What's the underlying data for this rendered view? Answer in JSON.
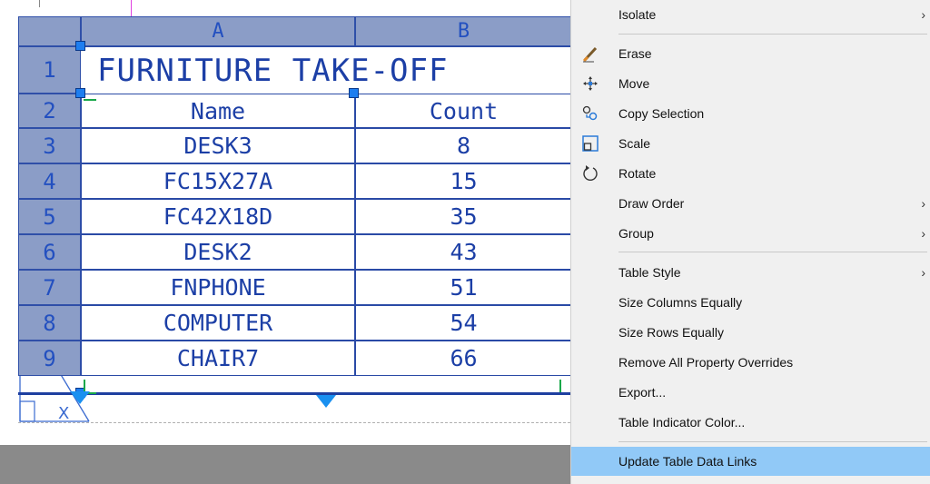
{
  "table": {
    "column_headers": [
      "A",
      "B"
    ],
    "row_numbers": [
      "1",
      "2",
      "3",
      "4",
      "5",
      "6",
      "7",
      "8",
      "9"
    ],
    "title": "FURNITURE TAKE-OFF",
    "header_row": [
      "Name",
      "Count"
    ],
    "rows": [
      [
        "DESK3",
        "8"
      ],
      [
        "FC15X27A",
        "15"
      ],
      [
        "FC42X18D",
        "35"
      ],
      [
        "DESK2",
        "43"
      ],
      [
        "FNPHONE",
        "51"
      ],
      [
        "COMPUTER",
        "54"
      ],
      [
        "CHAIR7",
        "66"
      ]
    ]
  },
  "context_menu": {
    "items": [
      {
        "label": "Isolate",
        "icon": "none",
        "submenu": true
      },
      {
        "label": "Erase",
        "icon": "eraser-icon",
        "submenu": false
      },
      {
        "label": "Move",
        "icon": "move-icon",
        "submenu": false
      },
      {
        "label": "Copy Selection",
        "icon": "copy-icon",
        "submenu": false
      },
      {
        "label": "Scale",
        "icon": "scale-icon",
        "submenu": false
      },
      {
        "label": "Rotate",
        "icon": "rotate-icon",
        "submenu": false
      },
      {
        "label": "Draw Order",
        "icon": "none",
        "submenu": true
      },
      {
        "label": "Group",
        "icon": "none",
        "submenu": true
      },
      {
        "label": "Table Style",
        "icon": "none",
        "submenu": true
      },
      {
        "label": "Size Columns Equally",
        "icon": "none",
        "submenu": false
      },
      {
        "label": "Size Rows Equally",
        "icon": "none",
        "submenu": false
      },
      {
        "label": "Remove All Property Overrides",
        "icon": "none",
        "submenu": false
      },
      {
        "label": "Export...",
        "icon": "none",
        "submenu": false
      },
      {
        "label": "Table Indicator Color...",
        "icon": "none",
        "submenu": false
      },
      {
        "label": "Update Table Data Links",
        "icon": "none",
        "submenu": false,
        "highlighted": true
      }
    ],
    "submenu_arrow": "›"
  },
  "colors": {
    "selection_fill": "#8b9dc7",
    "table_text": "#1c3fa6",
    "grip": "#1e7ef0",
    "menu_highlight": "#91c9f7"
  }
}
